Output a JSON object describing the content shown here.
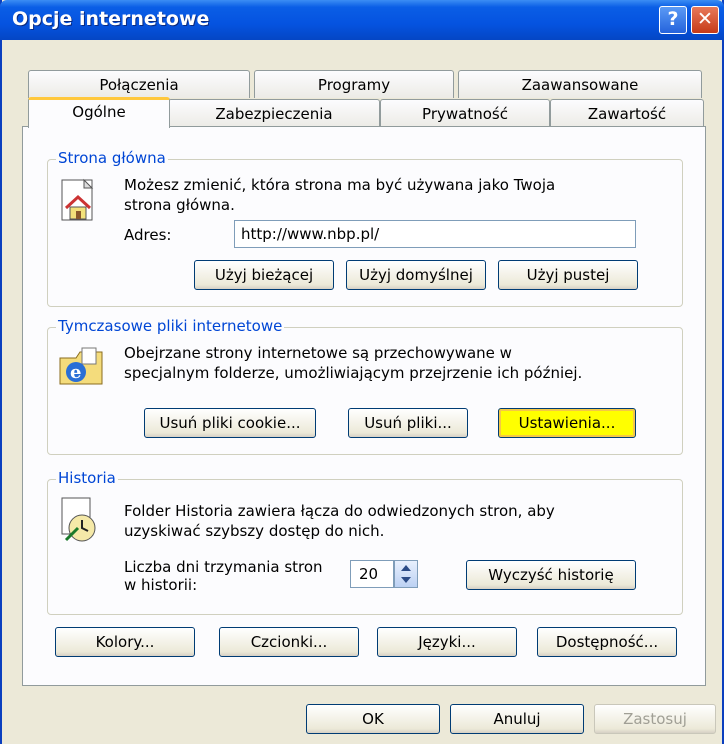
{
  "window": {
    "title": "Opcje internetowe",
    "help_glyph": "?",
    "close_glyph": "✕"
  },
  "tabs": {
    "back_row": [
      "Połączenia",
      "Programy",
      "Zaawansowane"
    ],
    "front_row": [
      "Ogólne",
      "Zabezpieczenia",
      "Prywatność",
      "Zawartość"
    ],
    "active": "Ogólne"
  },
  "home": {
    "label": "Strona główna",
    "description_line1": "Możesz zmienić, która strona ma być używana jako Twoja",
    "description_line2": "strona główna.",
    "address_label": "Adres:",
    "address_value": "http://www.nbp.pl/",
    "btn_current": "Użyj bieżącej",
    "btn_default": "Użyj domyślnej",
    "btn_blank": "Użyj pustej"
  },
  "temp_files": {
    "label": "Tymczasowe pliki internetowe",
    "description_line1": "Obejrzane strony internetowe są przechowywane w",
    "description_line2": "specjalnym folderze, umożliwiającym przejrzenie ich później.",
    "btn_cookies": "Usuń pliki cookie...",
    "btn_files": "Usuń pliki...",
    "btn_settings": "Ustawienia..."
  },
  "history": {
    "label": "Historia",
    "description_line1": "Folder Historia zawiera łącza do odwiedzonych stron, aby",
    "description_line2": "uzyskiwać szybszy dostęp do nich.",
    "days_label_line1": "Liczba dni trzymania stron",
    "days_label_line2": "w historii:",
    "days_value": "20",
    "btn_clear": "Wyczyść historię"
  },
  "bottom_buttons": [
    "Kolory...",
    "Czcionki...",
    "Języki...",
    "Dostępność..."
  ],
  "dialog_buttons": {
    "ok": "OK",
    "cancel": "Anuluj",
    "apply": "Zastosuj"
  }
}
